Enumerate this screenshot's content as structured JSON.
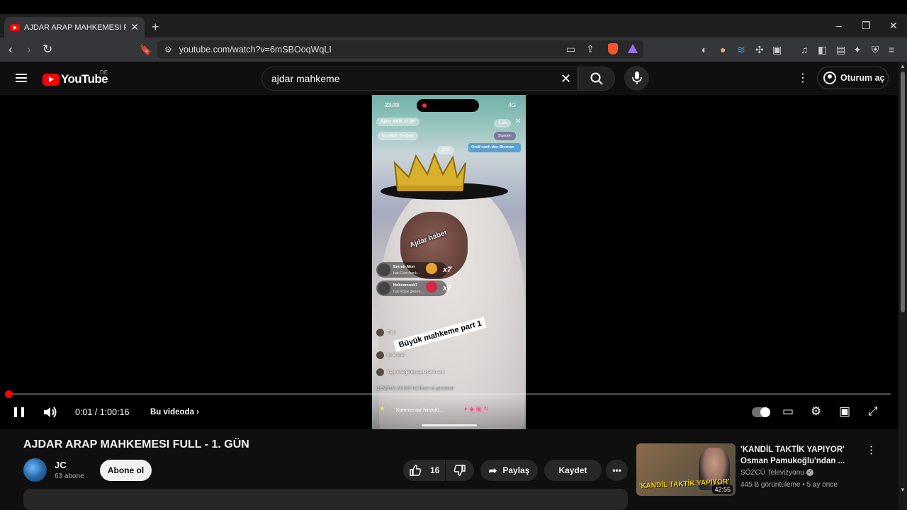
{
  "browser": {
    "tab_title": "AJDAR ARAP MAHKEMESI FULL",
    "tab_close": "✕",
    "new_tab": "+",
    "window_controls": [
      "–",
      "❐",
      "✕"
    ],
    "url": "youtube.com/watch?v=6mSBOoqWqLI"
  },
  "youtube": {
    "logo_text": "YouTube",
    "region": "DE",
    "search_query": "ajdar mahkeme",
    "signin_label": "Oturum aç"
  },
  "video_overlay": {
    "status_time": "23:33",
    "status_network": "4G",
    "streamer_name": "Ajdar ANIK",
    "streamer_sub": "11.9K",
    "pill_left": "Künstliche Beegleite",
    "pill_right": "Stunden",
    "viewer_count": "1.5K",
    "card_counter": "2/10",
    "card_text": "Greif nach den Sternen",
    "tilted_text": "Ajdar haber",
    "gift_rows": [
      {
        "name": "Emrah Akın",
        "sub": "hat Geschenk...",
        "count": "x7"
      },
      {
        "name": "Hokenmusk7",
        "sub": "hat Rose gesen...",
        "count": "x7"
      }
    ],
    "chat": [
      {
        "text": "Thor"
      },
      {
        "text": "bune kral"
      },
      {
        "text": "Yayını beğenip paylaşalım acil"
      },
      {
        "text": "GENERAL MUSIK hat Rose x1 gesendet"
      }
    ],
    "label": "Büyük mahkeme part 1",
    "comment_placeholder": "Kommentar hinzufü..."
  },
  "player": {
    "time": "0:01 / 1:00:16",
    "chapter": "Bu videoda",
    "progress": 0.0003
  },
  "video": {
    "title": "AJDAR ARAP MAHKEMESI FULL - 1. GÜN",
    "channel": "JC",
    "subscribers": "63 abone",
    "subscribe_label": "Abone ol",
    "likes": "16",
    "share_label": "Paylaş",
    "save_label": "Kaydet"
  },
  "recommendation": {
    "title": "'KANDİL TAKTİK YAPIYOR' Osman Pamukoğlu'ndan ...",
    "channel": "SÖZCÜ Televizyonu",
    "meta": "445 B görüntüleme • 5 ay önce",
    "duration": "42:55",
    "thumb_caption": "'KANDİL TAKTİK YAPIYOR'"
  },
  "colors": {
    "brand_red": "#ff0000",
    "background": "#0f0f0f",
    "pill": "#272727"
  }
}
